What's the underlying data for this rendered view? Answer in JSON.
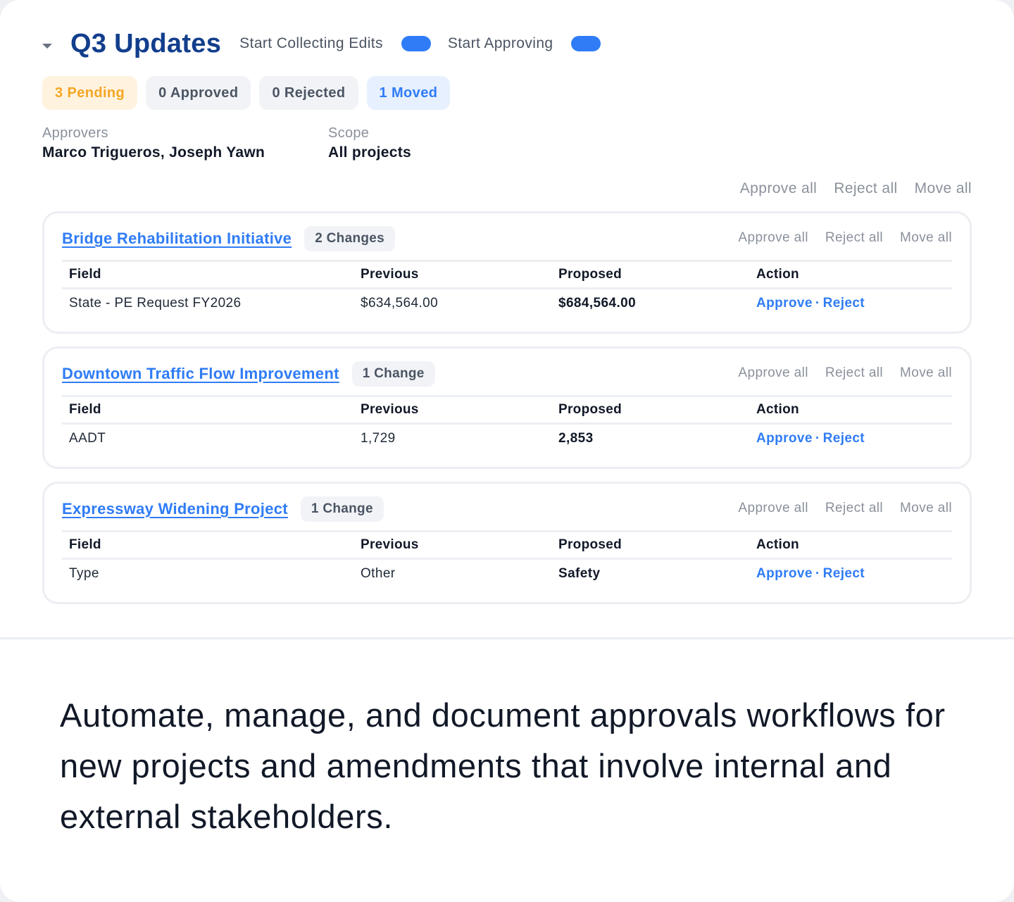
{
  "header": {
    "title": "Q3 Updates",
    "toggle1_label": "Start Collecting Edits",
    "toggle2_label": "Start Approving"
  },
  "stats": {
    "pending": "3 Pending",
    "approved": "0 Approved",
    "rejected": "0 Rejected",
    "moved": "1 Moved"
  },
  "meta": {
    "approvers_label": "Approvers",
    "approvers_value": "Marco Trigueros, Joseph Yawn",
    "scope_label": "Scope",
    "scope_value": "All projects"
  },
  "actions": {
    "approve_all": "Approve all",
    "reject_all": "Reject all",
    "move_all": "Move all"
  },
  "table_headers": {
    "field": "Field",
    "previous": "Previous",
    "proposed": "Proposed",
    "action": "Action"
  },
  "row_actions": {
    "approve": "Approve",
    "separator": "·",
    "reject": "Reject"
  },
  "projects": [
    {
      "name": "Bridge Rehabilitation Initiative",
      "changes": "2 Changes",
      "field": "State - PE Request FY2026",
      "previous": "$634,564.00",
      "proposed": "$684,564.00"
    },
    {
      "name": "Downtown Traffic Flow Improvement",
      "changes": "1 Change",
      "field": "AADT",
      "previous": "1,729",
      "proposed": "2,853"
    },
    {
      "name": "Expressway Widening Project",
      "changes": "1 Change",
      "field": "Type",
      "previous": "Other",
      "proposed": "Safety"
    }
  ],
  "footer": {
    "text": "Automate, manage, and document approvals workflows for new projects and amendments that involve internal and external stakeholders."
  },
  "colors": {
    "accent": "#2f7cf6",
    "title": "#123e8c",
    "pending": "#f5a623"
  }
}
